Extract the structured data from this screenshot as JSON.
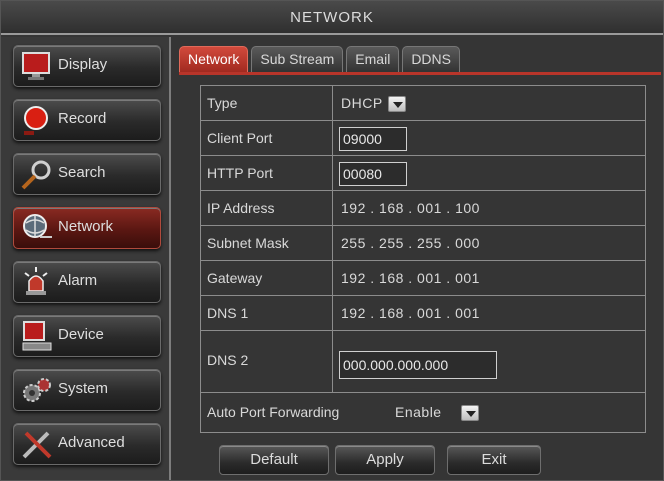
{
  "window": {
    "title": "NETWORK"
  },
  "sidebar": {
    "items": [
      {
        "label": "Display",
        "icon": "monitor-icon"
      },
      {
        "label": "Record",
        "icon": "record-icon"
      },
      {
        "label": "Search",
        "icon": "magnifier-icon"
      },
      {
        "label": "Network",
        "icon": "globe-network-icon",
        "active": true
      },
      {
        "label": "Alarm",
        "icon": "alarm-siren-icon"
      },
      {
        "label": "Device",
        "icon": "device-icon"
      },
      {
        "label": "System",
        "icon": "gears-icon"
      },
      {
        "label": "Advanced",
        "icon": "tools-icon"
      }
    ]
  },
  "tabs": [
    {
      "label": "Network",
      "active": true
    },
    {
      "label": "Sub Stream"
    },
    {
      "label": "Email"
    },
    {
      "label": "DDNS"
    }
  ],
  "form": {
    "type": {
      "label": "Type",
      "value": "DHCP"
    },
    "client_port": {
      "label": "Client Port",
      "value": "09000"
    },
    "http_port": {
      "label": "HTTP Port",
      "value": "00080"
    },
    "ip_address": {
      "label": "IP Address",
      "value": "192 . 168 . 001 . 100"
    },
    "subnet_mask": {
      "label": "Subnet Mask",
      "value": "255 . 255 . 255 . 000"
    },
    "gateway": {
      "label": "Gateway",
      "value": "192 . 168 . 001 . 001"
    },
    "dns1": {
      "label": "DNS 1",
      "value": "192 . 168 . 001 . 001"
    },
    "dns2": {
      "label": "DNS 2",
      "value": "000.000.000.000"
    },
    "auto_port_forwarding": {
      "label": "Auto Port Forwarding",
      "value": "Enable"
    }
  },
  "buttons": {
    "default": "Default",
    "apply": "Apply",
    "exit": "Exit"
  },
  "colors": {
    "accent": "#b8352a",
    "background": "#353535",
    "text": "#e6e6e6"
  }
}
